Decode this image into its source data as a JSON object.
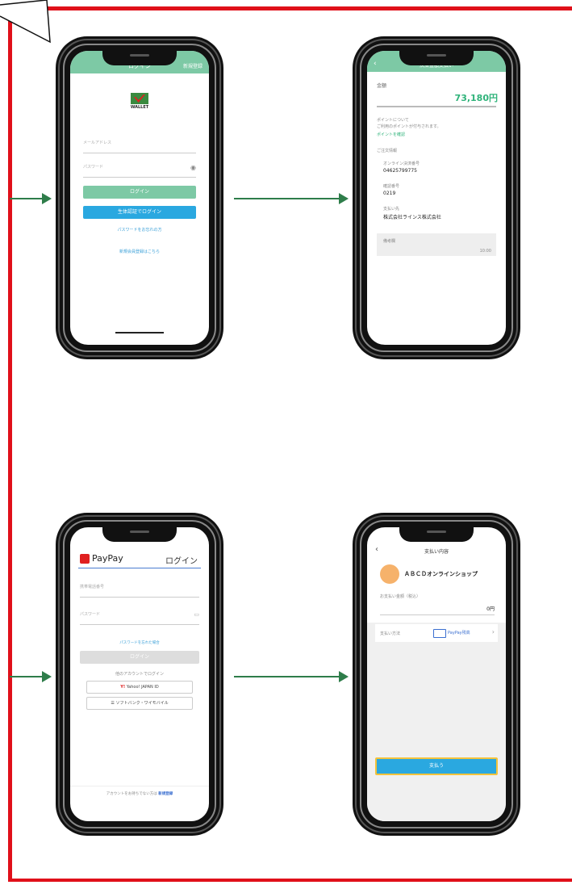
{
  "colors": {
    "frame": "#e0101a",
    "arrow": "#2e7d4a",
    "wallet_green": "#7dc9a5",
    "paypay_red": "#e02020",
    "link_blue": "#3ba0d8"
  },
  "phone1": {
    "header_title": "ログイン",
    "header_right": "新規登録",
    "logo_text": "WALLET",
    "email_placeholder": "メールアドレス",
    "password_placeholder": "パスワード",
    "eye_icon": "eye-icon",
    "login_button": "ログイン",
    "alt_login_button": "生体認証でログイン",
    "forgot_link": "パスワードをお忘れの方",
    "register_link": "新規会員登録はこちら"
  },
  "phone2": {
    "header_title": "決済金額支払い",
    "amount_label": "金額",
    "amount": "73,180円",
    "points_label": "ポイントについて",
    "points_desc": "ご利用のポイントが付与されます。",
    "points_link": "ポイントを確認",
    "shop_section": "ご注文情報",
    "shop_label": "オンライン決済番号",
    "shop_number": "04625799775",
    "code_label": "確認番号",
    "code_value": "0219",
    "company_label": "支払い先",
    "company_value": "株式会社ラインス株式会社",
    "note_label": "備考欄",
    "note_value": "10:00"
  },
  "phone3": {
    "brand": "PayPay",
    "title": "ログイン",
    "phone_placeholder": "携帯電話番号",
    "password_placeholder": "パスワード",
    "forgot_link": "パスワードを忘れた場合",
    "login_button": "ログイン",
    "other_accounts": "他のアカウントでログイン",
    "yahoo_button": "Yahoo! JAPAN ID",
    "softbank_button": "ソフトバンク・ワイモバイル",
    "footer_text": "アカウントをお持ちでない方は",
    "footer_link": "新規登録"
  },
  "phone4": {
    "header_title": "支払い内容",
    "shop_name": "ＡＢＣＤオンラインショップ",
    "amount_label": "お支払い金額（税込）",
    "amount_value": "0円",
    "method_label": "支払い方法",
    "method_value": "PayPay残高",
    "pay_button": "支払う"
  }
}
